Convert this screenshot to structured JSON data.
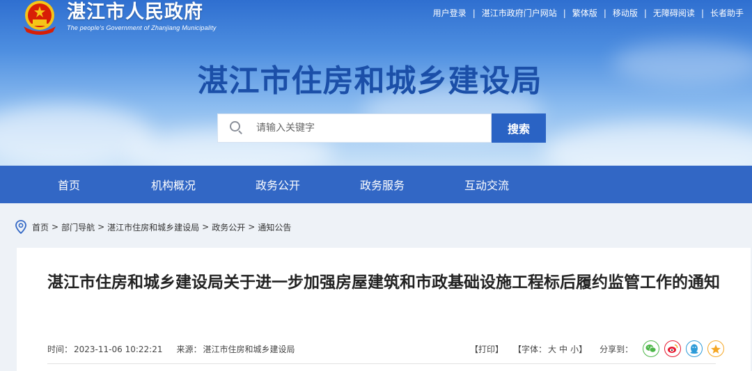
{
  "header": {
    "gov_name": "湛江市人民政府",
    "gov_name_en": "The people's Government of Zhanjiang Municipality",
    "bureau_title": "湛江市住房和城乡建设局",
    "top_links": [
      "用户登录",
      "湛江市政府门户网站",
      "繁体版",
      "移动版",
      "无障碍阅读",
      "长者助手"
    ]
  },
  "search": {
    "placeholder": "请输入关键字",
    "button_label": "搜索"
  },
  "nav": {
    "items": [
      "首页",
      "机构概况",
      "政务公开",
      "政务服务",
      "互动交流"
    ]
  },
  "breadcrumb": {
    "items": [
      "首页",
      "部门导航",
      "湛江市住房和城乡建设局",
      "政务公开",
      "通知公告"
    ],
    "separator": ">"
  },
  "article": {
    "title": "湛江市住房和城乡建设局关于进一步加强房屋建筑和市政基础设施工程标后履约监管工作的通知",
    "time_label": "时间：",
    "time_value": "2023-11-06 10:22:21",
    "source_label": "来源：",
    "source_value": "湛江市住房和城乡建设局",
    "print_label": "【打印】",
    "font_label": "【字体：",
    "font_large": "大",
    "font_medium": "中",
    "font_small": "小】",
    "share_label": "分享到：",
    "share_icons": [
      "wechat-icon",
      "weibo-icon",
      "qq-icon",
      "qzone-icon"
    ]
  },
  "colors": {
    "nav_bg": "#3267c5",
    "search_btn": "#2a63c4",
    "bureau_title": "#1b4fa8",
    "emblem_red": "#d81e06",
    "emblem_gold": "#f5c518",
    "wechat": "#4cb648",
    "weibo": "#e6162d",
    "qq": "#2d9bd8",
    "qzone": "#f5a623"
  }
}
